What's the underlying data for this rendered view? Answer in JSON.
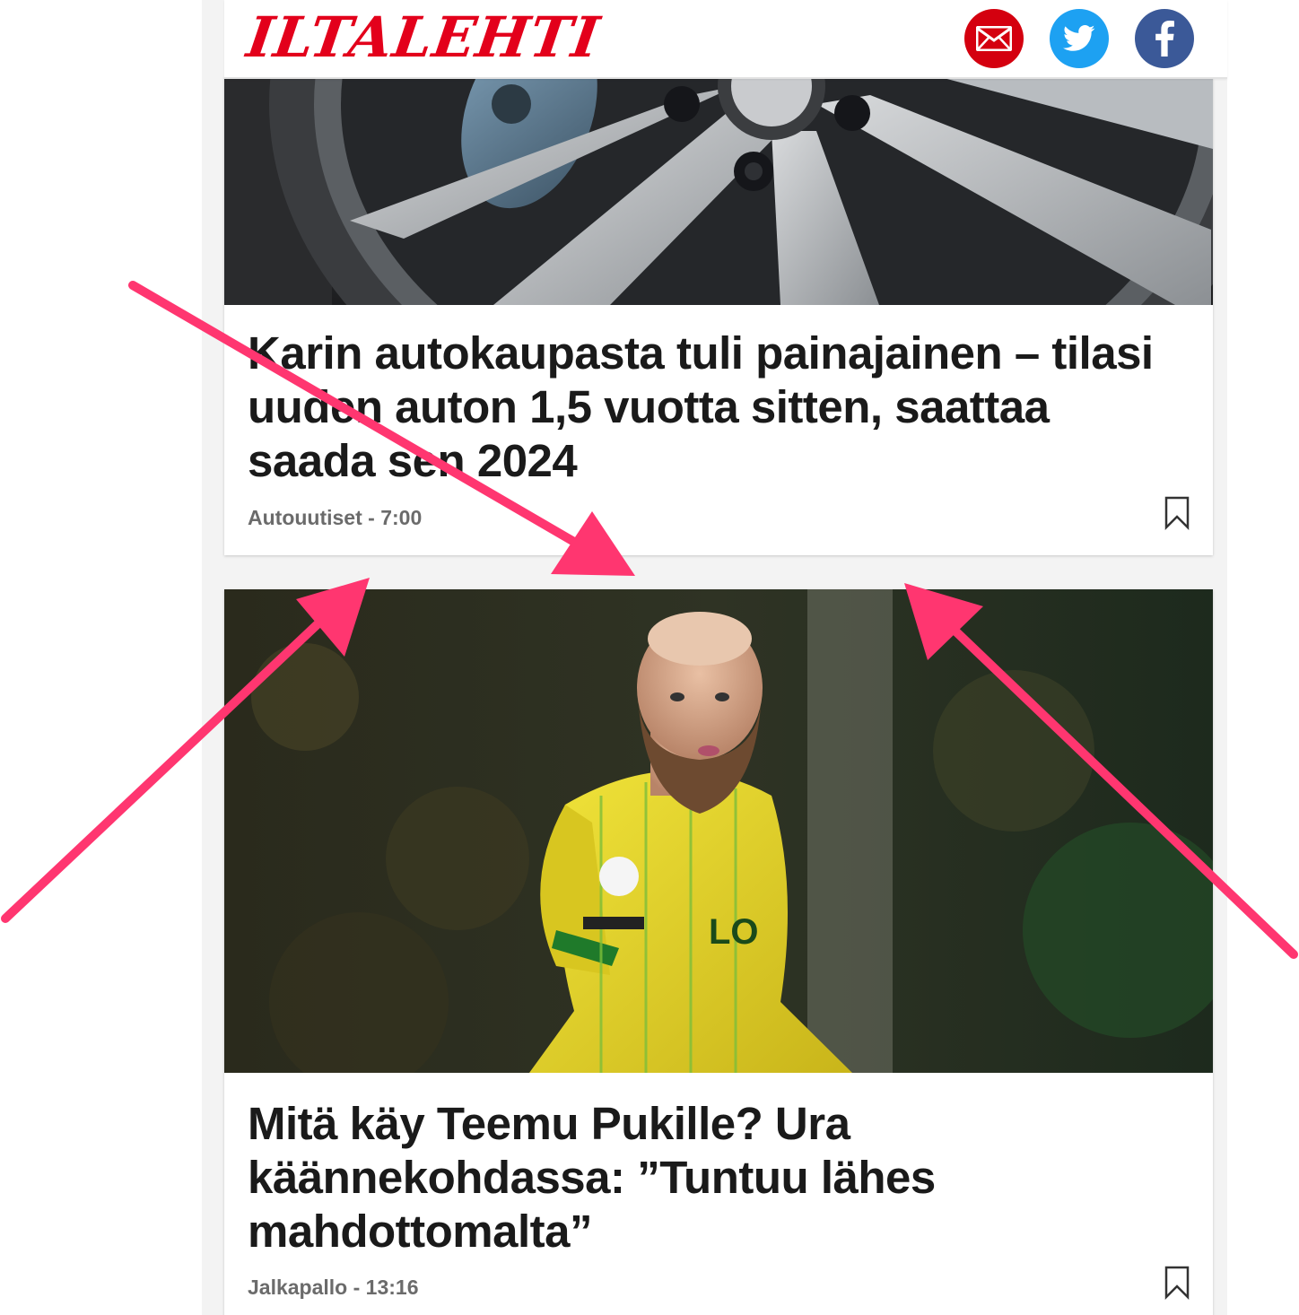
{
  "header": {
    "logo_text": "ILTALEHTI",
    "share": [
      {
        "icon": "mail-icon",
        "color": "#d4000f"
      },
      {
        "icon": "twitter-icon",
        "color": "#1da1f2"
      },
      {
        "icon": "facebook-icon",
        "color": "#3b5998"
      }
    ]
  },
  "articles": [
    {
      "headline": "Karin autokaupasta tuli painajainen – tilasi uuden auton 1,5 vuotta sitten, saattaa saada sen 2024",
      "meta": "Autouutiset - 7:00",
      "image": "car-wheel-photo"
    },
    {
      "headline": "Mitä käy Teemu Pukille? Ura käännekohdassa: ”Tuntuu lähes mahdottomalta”",
      "meta": "Jalkapallo - 13:16",
      "image": "football-player-photo"
    }
  ],
  "colors": {
    "brand": "#e3001b",
    "annotation_arrow": "#ff3670"
  }
}
